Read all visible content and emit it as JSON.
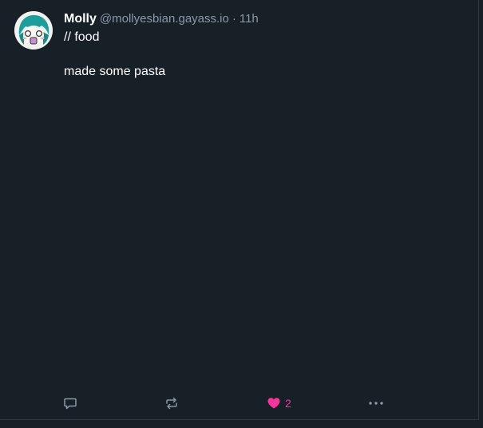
{
  "post": {
    "author_name": "Molly",
    "author_handle": "@mollyesbian.gayass.io",
    "separator": "·",
    "timestamp": "11h",
    "content_lines": [
      "// food",
      "made some pasta"
    ]
  },
  "actions": {
    "reply_icon": "speech-bubble-icon",
    "boost_icon": "repost-icon",
    "like_icon": "heart-icon",
    "like_count": "2",
    "more_icon": "ellipsis-icon"
  },
  "colors": {
    "background": "#171f27",
    "text": "#ffffff",
    "muted": "#8b98a5",
    "like": "#f6359a",
    "avatar_hair": "#1e9e9b"
  }
}
